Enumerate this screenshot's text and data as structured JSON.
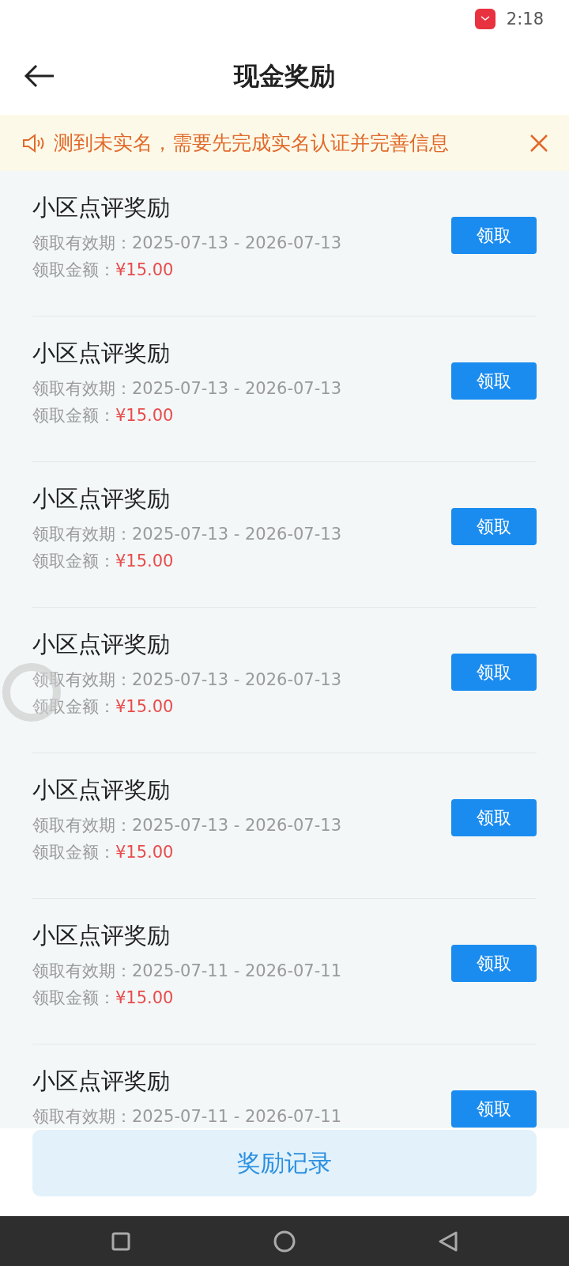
{
  "status_bar": {
    "time": "2:18"
  },
  "header": {
    "title": "现金奖励"
  },
  "notice": {
    "text": "测到未实名，需要先完成实名认证并完善信息"
  },
  "rewards": [
    {
      "title": "小区点评奖励",
      "validity_label": "领取有效期：",
      "validity": "2025-07-13 - 2026-07-13",
      "amount_label": "领取金额：",
      "amount": "¥15.00",
      "button": "领取"
    },
    {
      "title": "小区点评奖励",
      "validity_label": "领取有效期：",
      "validity": "2025-07-13 - 2026-07-13",
      "amount_label": "领取金额：",
      "amount": "¥15.00",
      "button": "领取"
    },
    {
      "title": "小区点评奖励",
      "validity_label": "领取有效期：",
      "validity": "2025-07-13 - 2026-07-13",
      "amount_label": "领取金额：",
      "amount": "¥15.00",
      "button": "领取"
    },
    {
      "title": "小区点评奖励",
      "validity_label": "领取有效期：",
      "validity": "2025-07-13 - 2026-07-13",
      "amount_label": "领取金额：",
      "amount": "¥15.00",
      "button": "领取"
    },
    {
      "title": "小区点评奖励",
      "validity_label": "领取有效期：",
      "validity": "2025-07-13 - 2026-07-13",
      "amount_label": "领取金额：",
      "amount": "¥15.00",
      "button": "领取"
    },
    {
      "title": "小区点评奖励",
      "validity_label": "领取有效期：",
      "validity": "2025-07-11 - 2026-07-11",
      "amount_label": "领取金额：",
      "amount": "¥15.00",
      "button": "领取"
    },
    {
      "title": "小区点评奖励",
      "validity_label": "领取有效期：",
      "validity": "2025-07-11 - 2026-07-11",
      "button": "领取"
    }
  ],
  "footer_button": "奖励记录"
}
